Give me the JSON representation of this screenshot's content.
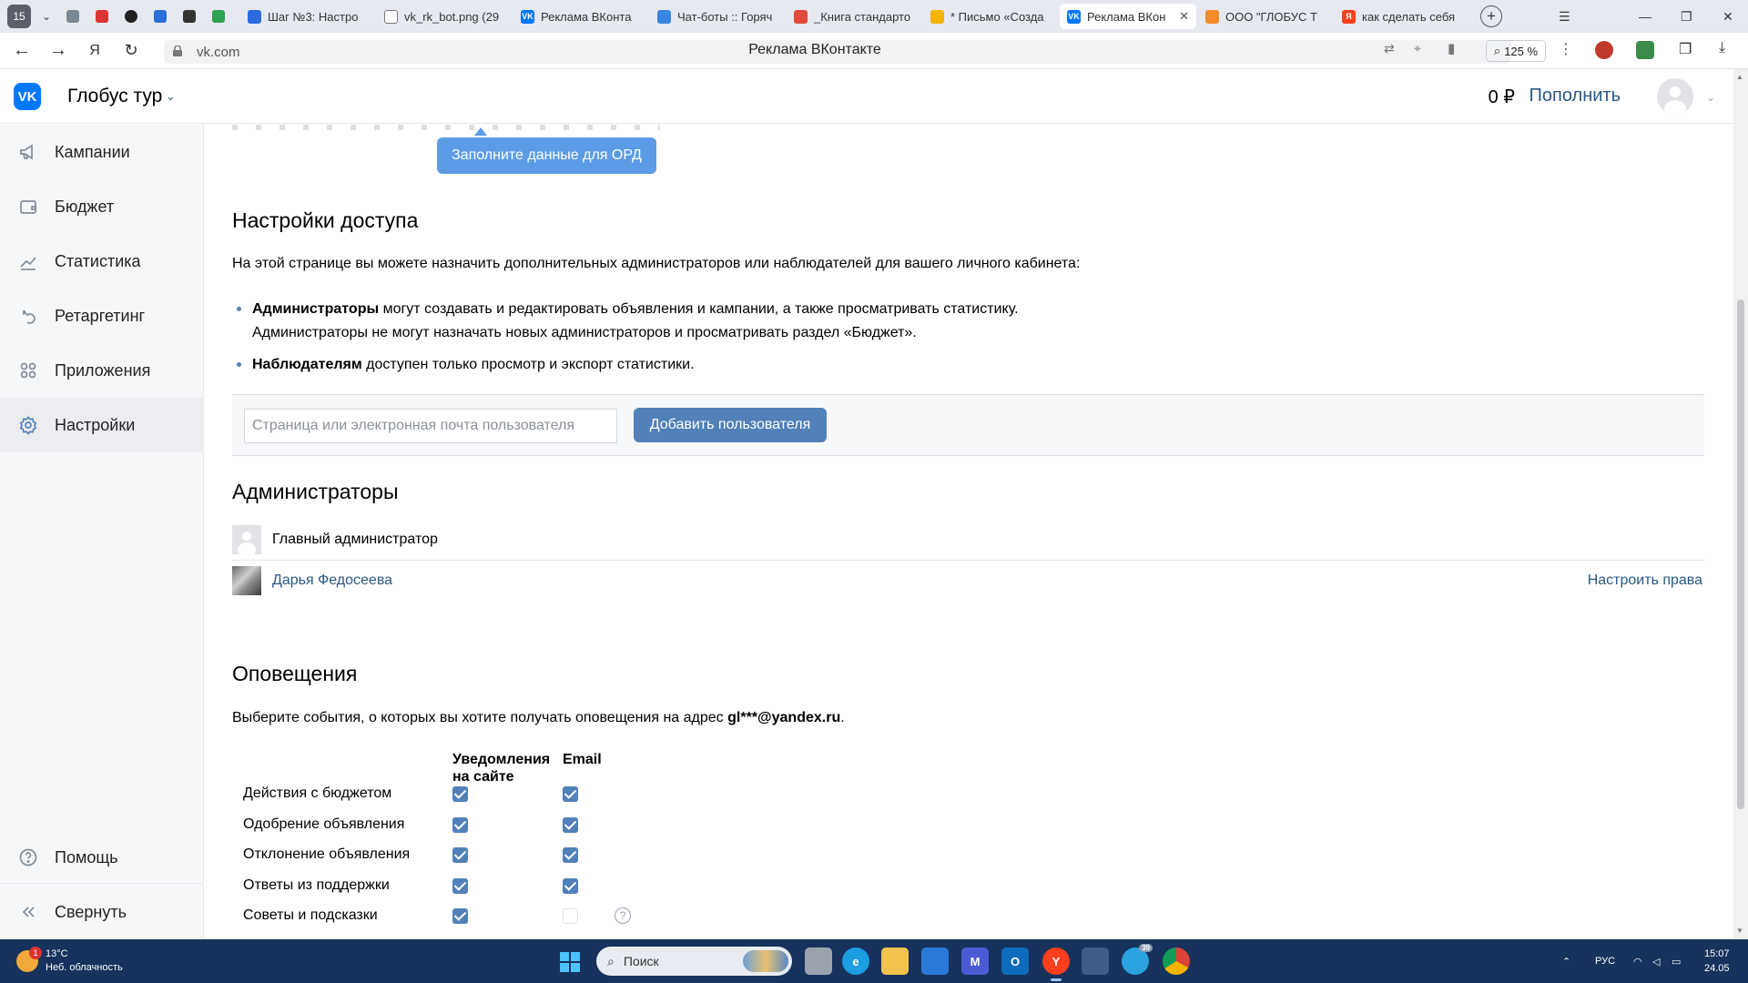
{
  "browser": {
    "tab_count": "15",
    "tabs": [
      {
        "title": "Шаг №3: Настро",
        "fav": "#2d6cdf",
        "glyph": ""
      },
      {
        "title": "vk_rk_bot.png (29",
        "fav": "#ffffff",
        "glyph": ""
      },
      {
        "title": "Реклама ВКонта",
        "fav": "#0077ff",
        "glyph": "VK"
      },
      {
        "title": "Чат-боты :: Горяч",
        "fav": "#3b86e0",
        "glyph": ""
      },
      {
        "title": "_Книга стандарто",
        "fav": "#e24a3b",
        "glyph": ""
      },
      {
        "title": "* Письмо «Созда",
        "fav": "#f4b400",
        "glyph": ""
      },
      {
        "title": "Реклама ВКон",
        "fav": "#0077ff",
        "glyph": "VK",
        "active": true
      },
      {
        "title": "ООО \"ГЛОБУС Т",
        "fav": "#f28c28",
        "glyph": ""
      },
      {
        "title": "как сделать себя",
        "fav": "#fc3f1d",
        "glyph": "Я"
      }
    ],
    "url_host": "vk.com",
    "page_title": "Реклама ВКонтакте",
    "zoom": "125 %"
  },
  "header": {
    "account": "Глобус тур",
    "balance": "0 ₽",
    "topup": "Пополнить"
  },
  "sidebar": {
    "items": [
      {
        "label": "Кампании",
        "icon": "megaphone-icon"
      },
      {
        "label": "Бюджет",
        "icon": "wallet-icon"
      },
      {
        "label": "Статистика",
        "icon": "chart-icon"
      },
      {
        "label": "Ретаргетинг",
        "icon": "retarget-icon"
      },
      {
        "label": "Приложения",
        "icon": "apps-icon"
      },
      {
        "label": "Настройки",
        "icon": "gear-icon",
        "active": true
      }
    ],
    "help": "Помощь",
    "collapse": "Свернуть"
  },
  "main": {
    "ord_button": "Заполните данные для ОРД",
    "access": {
      "title": "Настройки доступа",
      "intro": "На этой странице вы можете назначить дополнительных администраторов или наблюдателей для вашего личного кабинета:",
      "admins_bold": "Администраторы",
      "admins_text1": " могут создавать и редактировать объявления и кампании, а также просматривать статистику.",
      "admins_text2": "Администраторы не могут назначать новых администраторов и просматривать раздел «Бюджет».",
      "viewers_bold": "Наблюдателям",
      "viewers_text": " доступен только просмотр и экспорт статистики.",
      "input_placeholder": "Страница или электронная почта пользователя",
      "add_button": "Добавить пользователя"
    },
    "admins": {
      "title": "Администраторы",
      "main_admin": "Главный администратор",
      "user_name": "Дарья Федосеева",
      "rights_link": "Настроить права"
    },
    "notifications": {
      "title": "Оповещения",
      "intro": "Выберите события, о которых вы хотите получать оповещения на адрес ",
      "email": "gl***@yandex.ru",
      "intro_end": ".",
      "col_site_1": "Уведомления",
      "col_site_2": "на сайте",
      "col_email": "Email",
      "rows": [
        {
          "label": "Действия с бюджетом",
          "site": true,
          "email": true
        },
        {
          "label": "Одобрение объявления",
          "site": true,
          "email": true
        },
        {
          "label": "Отклонение объявления",
          "site": true,
          "email": true
        },
        {
          "label": "Ответы из поддержки",
          "site": true,
          "email": true
        },
        {
          "label": "Советы и подсказки",
          "site": true,
          "email": false,
          "help": true
        }
      ]
    }
  },
  "taskbar": {
    "temp": "13°C",
    "weather": "Неб. облачность",
    "weather_badge": "1",
    "search": "Поиск",
    "lang": "РУС",
    "time": "15:07",
    "date": "24.05",
    "telegram_badge": "39"
  },
  "colors": {
    "vk_blue": "#0077ff",
    "link": "#2a5885",
    "button": "#5181b8",
    "ord_button": "#5c9ce6"
  }
}
